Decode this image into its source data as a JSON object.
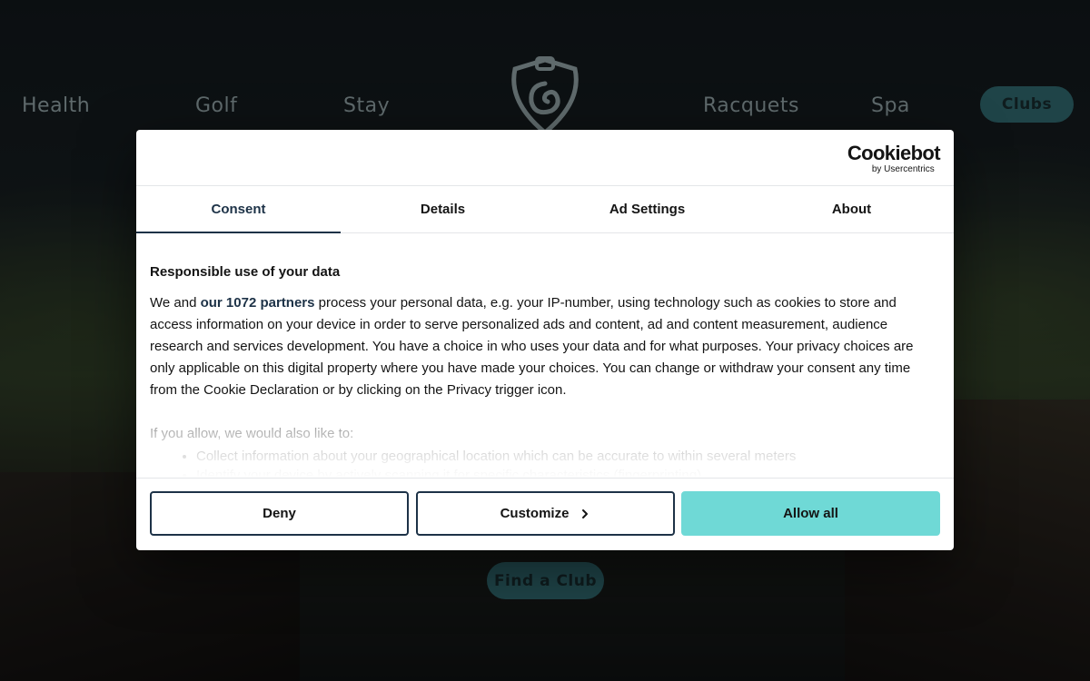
{
  "nav": {
    "health": "Health",
    "golf": "Golf",
    "stay": "Stay",
    "racquets": "Racquets",
    "spa": "Spa",
    "clubs": "Clubs"
  },
  "hero": {
    "find_club": "Find a Club"
  },
  "dialog": {
    "brand_name": "Cookiebot",
    "brand_sub": "by Usercentrics",
    "tabs": [
      {
        "label": "Consent",
        "active": true
      },
      {
        "label": "Details"
      },
      {
        "label": "Ad Settings"
      },
      {
        "label": "About"
      }
    ],
    "title": "Responsible use of your data",
    "text_before": "We and ",
    "partners_link": "our 1072 partners",
    "text_after": " process your personal data, e.g. your IP-number, using technology such as cookies to store and access information on your device in order to serve personalized ads and content, ad and content measurement, audience research and services development. You have a choice in who uses your data and for what purposes. Your privacy choices are only applicable on this digital property where you have made your choices. You can change or withdraw your consent any time from the Cookie Declaration or by clicking on the Privacy trigger icon.",
    "allow_intro": "If you allow, we would also like to:",
    "allow_items": [
      "Collect information about your geographical location which can be accurate to within several meters",
      "Identify your device by actively scanning it for specific characteristics (fingerprinting)"
    ],
    "buttons": {
      "deny": "Deny",
      "customize": "Customize",
      "allow_all": "Allow all"
    }
  },
  "colors": {
    "accent": "#6fd9d6",
    "navy": "#1d3247",
    "nav_pill": "#1f4448"
  }
}
